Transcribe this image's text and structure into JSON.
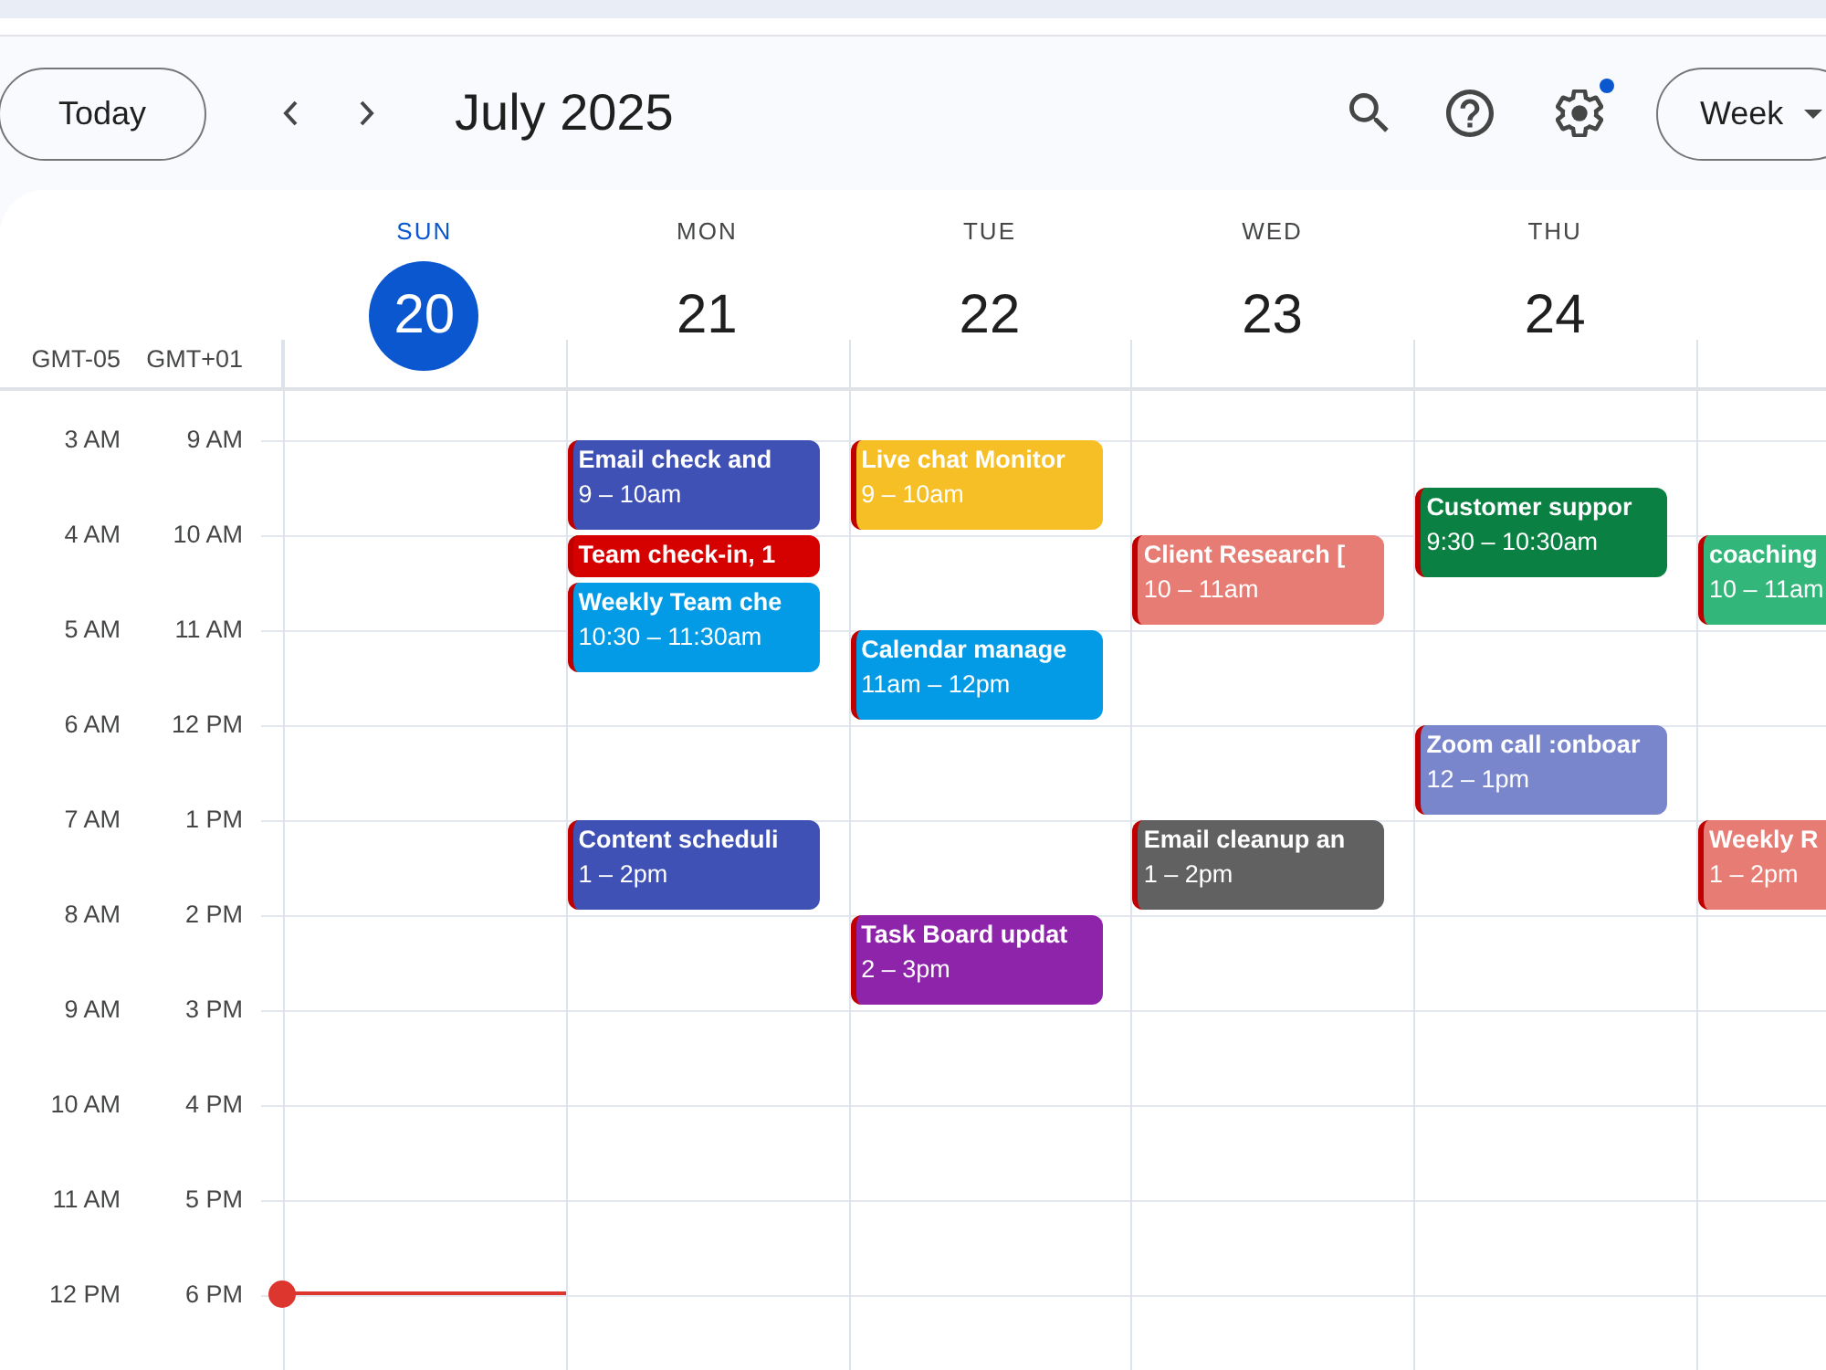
{
  "toolbar": {
    "today_button": "Today",
    "title": "July 2025",
    "view_button": "Week",
    "settings_badge": true
  },
  "timezones": [
    "GMT-05",
    "GMT+01"
  ],
  "hours": [
    {
      "local": "3 AM",
      "secondary": "9 AM",
      "now": false
    },
    {
      "local": "4 AM",
      "secondary": "10 AM",
      "now": false
    },
    {
      "local": "5 AM",
      "secondary": "11 AM",
      "now": false
    },
    {
      "local": "6 AM",
      "secondary": "12 PM",
      "now": false
    },
    {
      "local": "7 AM",
      "secondary": "1 PM",
      "now": false
    },
    {
      "local": "8 AM",
      "secondary": "2 PM",
      "now": false
    },
    {
      "local": "9 AM",
      "secondary": "3 PM",
      "now": false
    },
    {
      "local": "10 AM",
      "secondary": "4 PM",
      "now": false
    },
    {
      "local": "11 AM",
      "secondary": "5 PM",
      "now": false
    },
    {
      "local": "12 PM",
      "secondary": "6 PM",
      "now": true
    }
  ],
  "days": [
    {
      "name": "SUN",
      "number": "20",
      "today": true
    },
    {
      "name": "MON",
      "number": "21",
      "today": false,
      "events": [
        {
          "title": "Email check and",
          "time": "9 – 10am",
          "color": "#3f51b5"
        },
        {
          "title": "Team check-in, 1",
          "color": "#d50000"
        },
        {
          "title": "Weekly Team che",
          "time": "10:30 – 11:30am",
          "color": "#039be5"
        },
        {
          "title": "Content scheduli",
          "time": "1 – 2pm",
          "color": "#3f51b5"
        }
      ]
    },
    {
      "name": "TUE",
      "number": "22",
      "today": false,
      "events": [
        {
          "title": "Live chat Monitor",
          "time": "9 – 10am",
          "color": "#f6bf26"
        },
        {
          "title": "Calendar manage",
          "time": "11am – 12pm",
          "color": "#039be5"
        },
        {
          "title": "Task Board updat",
          "time": "2 – 3pm",
          "color": "#8e24aa"
        }
      ]
    },
    {
      "name": "WED",
      "number": "23",
      "today": false,
      "events": [
        {
          "title": "Client Research [",
          "time": "10 – 11am",
          "color": "#e67c73"
        },
        {
          "title": "Email cleanup an",
          "time": "1 – 2pm",
          "color": "#616161"
        }
      ]
    },
    {
      "name": "THU",
      "number": "24",
      "today": false,
      "events": [
        {
          "title": "Customer suppor",
          "time": "9:30 – 10:30am",
          "color": "#0b8043"
        },
        {
          "title": "Zoom call :onboar",
          "time": "12 – 1pm",
          "color": "#7986cb"
        }
      ]
    },
    {
      "events": [
        {
          "title": "coaching",
          "time": "10 – 11am",
          "color": "#33b679"
        },
        {
          "title": "Weekly R",
          "time": "1 – 2pm",
          "color": "#e67c73"
        }
      ]
    }
  ]
}
